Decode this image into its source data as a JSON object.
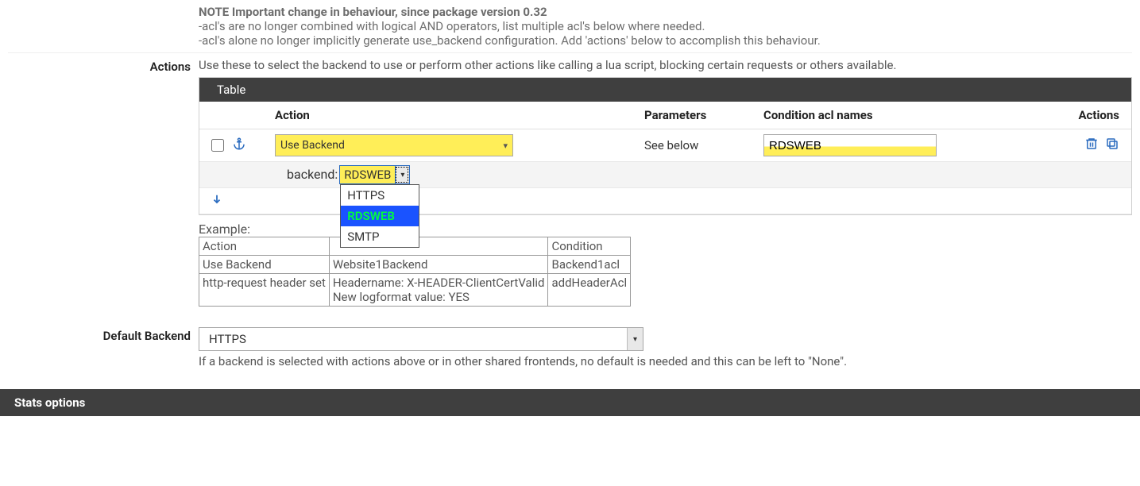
{
  "note": {
    "title": "NOTE Important change in behaviour, since package version 0.32",
    "line1": "-acl's are no longer combined with logical AND operators, list multiple acl's below where needed.",
    "line2": "-acl's alone no longer implicitly generate use_backend configuration. Add 'actions' below to accomplish this behaviour."
  },
  "actions": {
    "label": "Actions",
    "desc": "Use these to select the backend to use or perform other actions like calling a lua script, blocking certain requests or others available.",
    "table_title": "Table",
    "headers": {
      "action": "Action",
      "parameters": "Parameters",
      "condition": "Condition acl names",
      "actions": "Actions"
    },
    "row": {
      "action_value": "Use Backend",
      "parameters_value": "See below",
      "condition_value": "RDSWEB"
    },
    "backend_row": {
      "label": "backend:",
      "value": "RDSWEB",
      "options": [
        "HTTPS",
        "RDSWEB",
        "SMTP"
      ]
    }
  },
  "example": {
    "label": "Example:",
    "headers": {
      "action": "Action",
      "p1": "",
      "condition": "Condition"
    },
    "rows": [
      {
        "action": "Use Backend",
        "p": "Website1Backend",
        "cond": "Backend1acl"
      },
      {
        "action": "http-request header set",
        "p": "Headername: X-HEADER-ClientCertValid\nNew logformat value: YES",
        "cond": "addHeaderAcl"
      }
    ]
  },
  "default_backend": {
    "label": "Default Backend",
    "value": "HTTPS",
    "help": "If a backend is selected with actions above or in other shared frontends, no default is needed and this can be left to \"None\"."
  },
  "stats": {
    "title": "Stats options"
  }
}
